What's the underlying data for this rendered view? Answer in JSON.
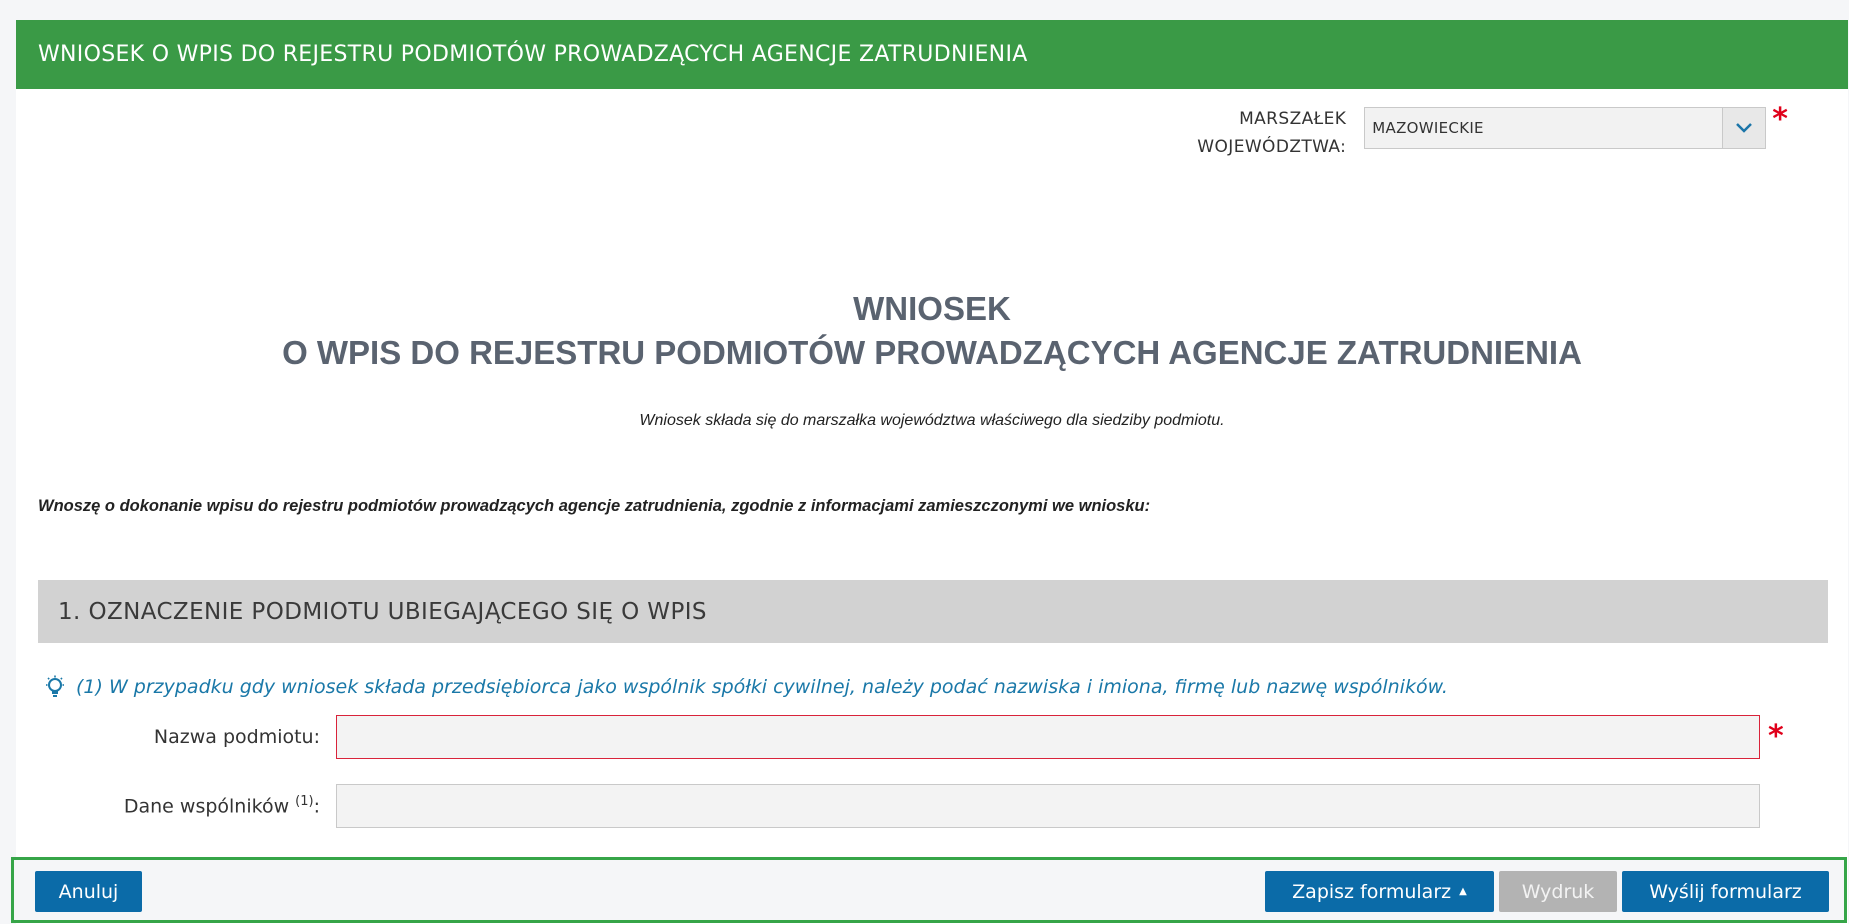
{
  "header": {
    "title": "WNIOSEK O WPIS DO REJESTRU PODMIOTÓW PROWADZĄCYCH AGENCJE ZATRUDNIENIA"
  },
  "marszalek": {
    "label_line1": "MARSZAŁEK",
    "label_line2": "WOJEWÓDZTWA:",
    "selected_value": "MAZOWIECKIE",
    "required_mark": "*"
  },
  "document": {
    "title_line1": "WNIOSEK",
    "title_line2": "O WPIS DO REJESTRU PODMIOTÓW PROWADZĄCYCH AGENCJE ZATRUDNIENIA",
    "subtitle": "Wniosek składa się do marszałka województwa właściwego dla siedziby podmiotu.",
    "declaration": "Wnoszę o dokonanie wpisu do rejestru podmiotów prowadzących agencje zatrudnienia, zgodnie z informacjami zamieszczonymi we wniosku:"
  },
  "section1": {
    "title": "1. OZNACZENIE PODMIOTU UBIEGAJĄCEGO SIĘ O WPIS",
    "hint": "(1) W przypadku gdy wniosek składa przedsiębiorca jako wspólnik spółki cywilnej, należy podać nazwiska i imiona, firmę lub nazwę wspólników.",
    "fields": {
      "nazwa_label": "Nazwa podmiotu:",
      "nazwa_value": "",
      "wspolnicy_label": "Dane wspólników",
      "wspolnicy_sup": "(1)",
      "wspolnicy_colon": ":",
      "wspolnicy_value": "",
      "required_mark": "*"
    }
  },
  "footer": {
    "cancel_label": "Anuluj",
    "save_label": "Zapisz formularz",
    "print_label": "Wydruk",
    "send_label": "Wyślij formularz"
  },
  "colors": {
    "header_green": "#3a9a46",
    "button_blue": "#0b6ba8",
    "hint_blue": "#1a78a8",
    "required_red": "#e0001a"
  }
}
